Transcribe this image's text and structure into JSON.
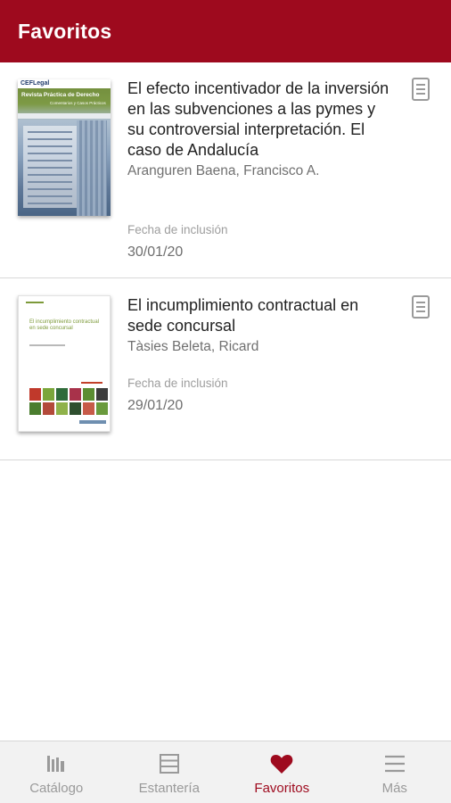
{
  "appbar": {
    "title": "Favoritos"
  },
  "items": [
    {
      "title": "El efecto incentivador de la inversión en las subvenciones a las pymes y su controversial interpretación. El caso de Andalucía",
      "author": "Aranguren Baena, Francisco A.",
      "date_label": "Fecha de inclusión",
      "date": "30/01/20",
      "cover": {
        "publisher": "CEFLegal",
        "journal": "Revista Práctica de Derecho",
        "subtitle": "Comentarios y Casos Prácticos"
      }
    },
    {
      "title": "El incumplimiento contractual en sede concursal",
      "author": "Tàsies Beleta, Ricard",
      "date_label": "Fecha de inclusión",
      "date": "29/01/20",
      "cover": {
        "title": "El incumplimiento contractual en sede concursal"
      }
    }
  ],
  "bottom_nav": [
    {
      "label": "Catálogo",
      "icon": "catalog-icon",
      "active": false
    },
    {
      "label": "Estantería",
      "icon": "shelf-icon",
      "active": false
    },
    {
      "label": "Favoritos",
      "icon": "heart-icon",
      "active": true
    },
    {
      "label": "Más",
      "icon": "menu-icon",
      "active": false
    }
  ],
  "colors": {
    "primary": "#9e0a1e",
    "inactive": "#9a9a9a"
  }
}
